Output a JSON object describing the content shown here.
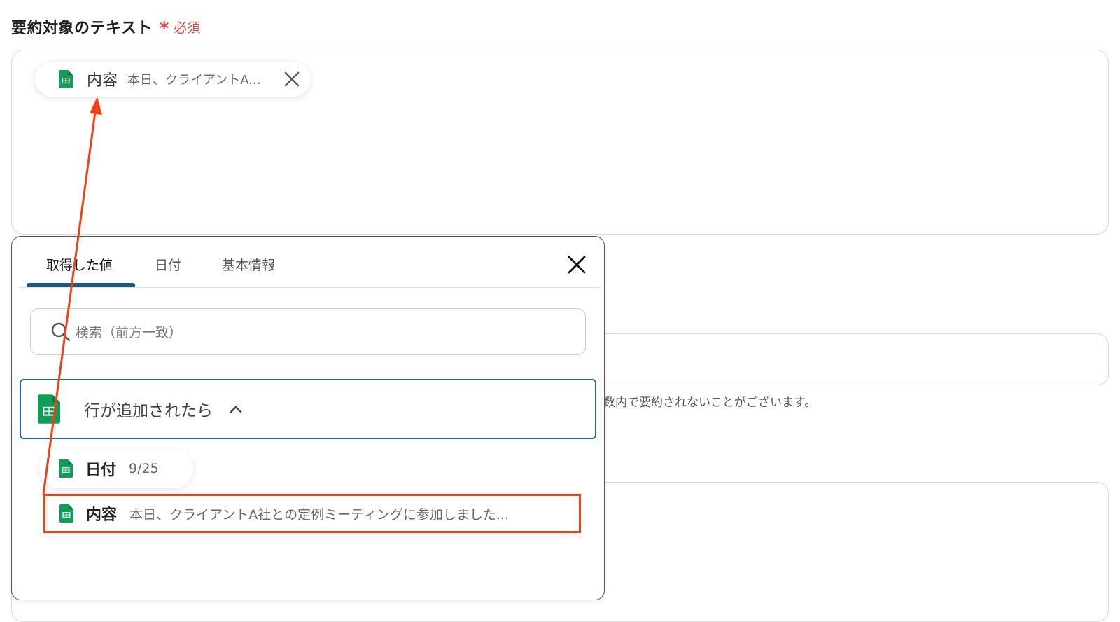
{
  "field": {
    "label": "要約対象のテキスト",
    "required_mark": "*",
    "required_text": "必須"
  },
  "textarea_chip": {
    "label": "内容",
    "value": "本日、クライアントA..."
  },
  "background": {
    "hint": "数内で要約されないことがございます。"
  },
  "panel": {
    "tabs": [
      {
        "label": "取得した値",
        "active": true
      },
      {
        "label": "日付",
        "active": false
      },
      {
        "label": "基本情報",
        "active": false
      }
    ],
    "search_placeholder": "検索（前方一致）",
    "group": {
      "label": "行が追加されたら",
      "items": [
        {
          "label": "日付",
          "value": "9/25"
        },
        {
          "label": "内容",
          "value": "本日、クライアントA社との定例ミーティングに参加しました..."
        }
      ]
    }
  },
  "colors": {
    "required": "#e5484d",
    "sheets_green": "#0f9d58",
    "highlight": "#ee4217",
    "group_border": "#1e5fc1",
    "tab_underline": "#1f5a7a"
  }
}
